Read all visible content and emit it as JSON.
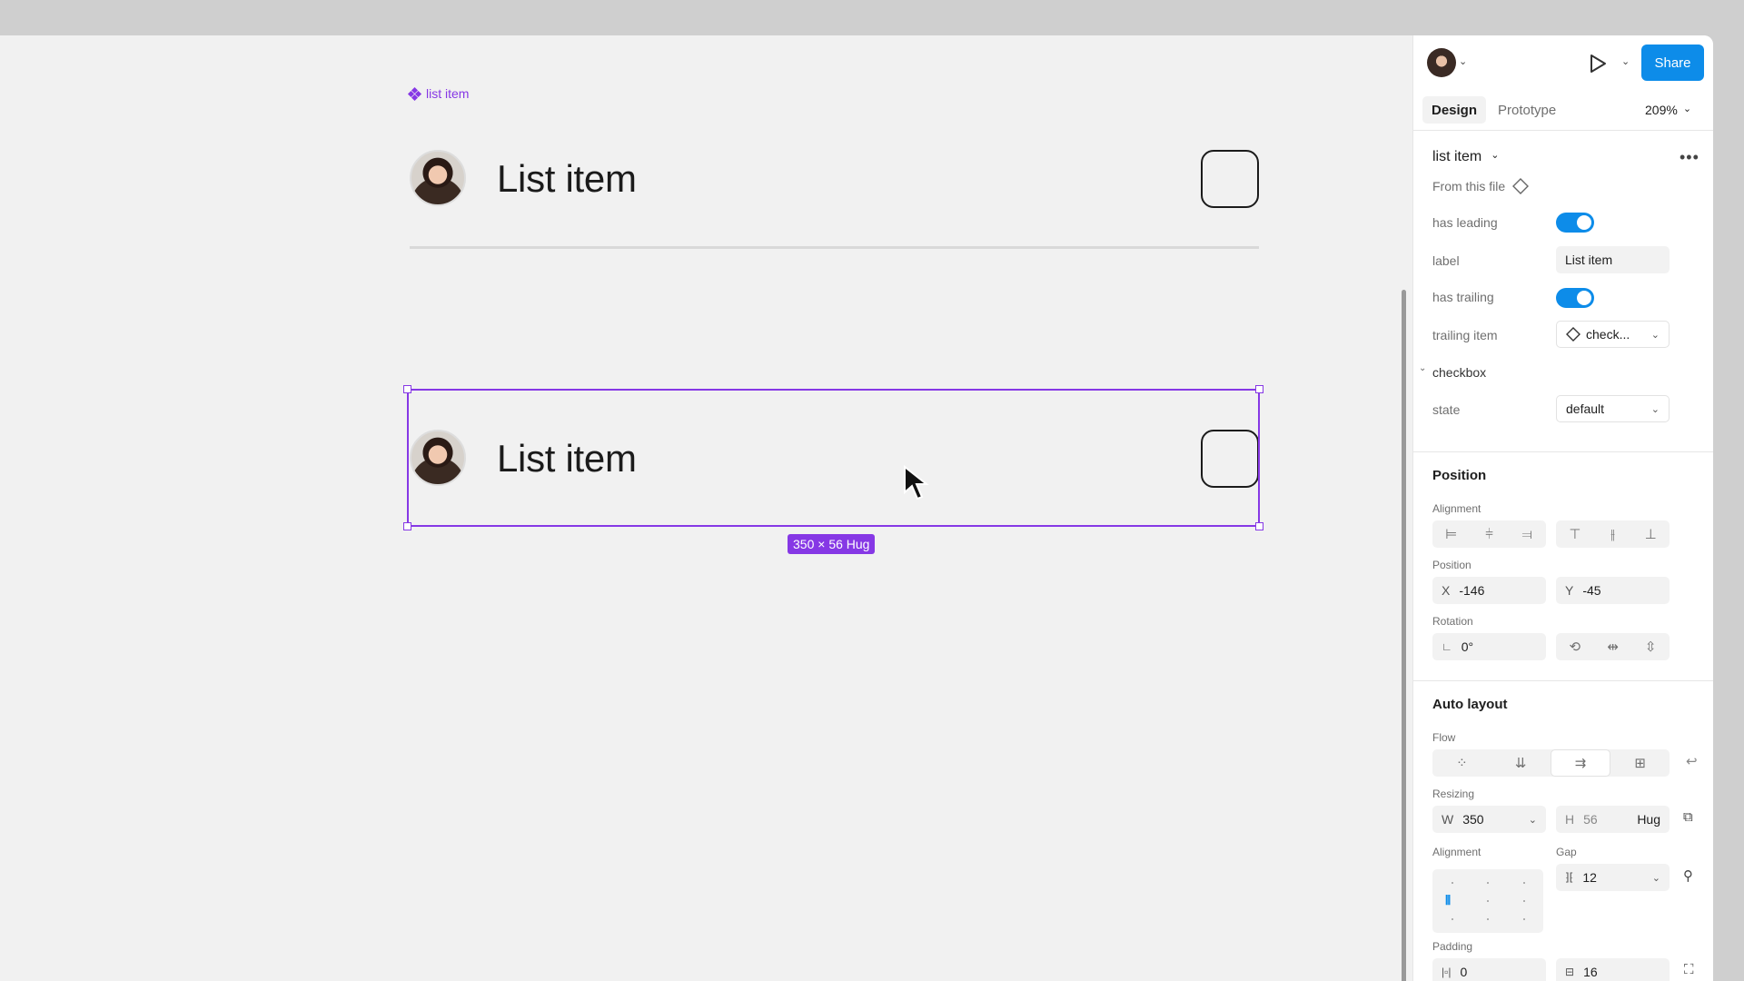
{
  "canvas": {
    "component_tag": "list item",
    "rows": [
      {
        "label": "List item"
      },
      {
        "label": "List item"
      }
    ],
    "selection_size": "350 × 56 Hug"
  },
  "panel": {
    "header": {
      "share_label": "Share"
    },
    "tabs": [
      {
        "label": "Design"
      },
      {
        "label": "Prototype"
      }
    ],
    "zoom": "209%",
    "component": {
      "name": "list item",
      "source": "From this file",
      "props": {
        "has_leading_label": "has leading",
        "has_leading": true,
        "label_label": "label",
        "label_value": "List item",
        "has_trailing_label": "has trailing",
        "has_trailing": true,
        "trailing_item_label": "trailing item",
        "trailing_item_value": "check..."
      },
      "nested": {
        "name": "checkbox",
        "state_label": "state",
        "state_value": "default"
      }
    },
    "position": {
      "title": "Position",
      "alignment_label": "Alignment",
      "position_label": "Position",
      "x_prefix": "X",
      "x": "-146",
      "y_prefix": "Y",
      "y": "-45",
      "rotation_label": "Rotation",
      "rotation": "0°"
    },
    "auto_layout": {
      "title": "Auto layout",
      "flow_label": "Flow",
      "resizing_label": "Resizing",
      "w_prefix": "W",
      "w": "350",
      "h_prefix": "H",
      "h": "56",
      "h_mode": "Hug",
      "alignment_label": "Alignment",
      "gap_label": "Gap",
      "gap": "12",
      "padding_label": "Padding",
      "padding_h": "0",
      "padding_v": "16"
    }
  },
  "colors": {
    "selection": "#8638e5",
    "accent": "#0d8ce9"
  }
}
